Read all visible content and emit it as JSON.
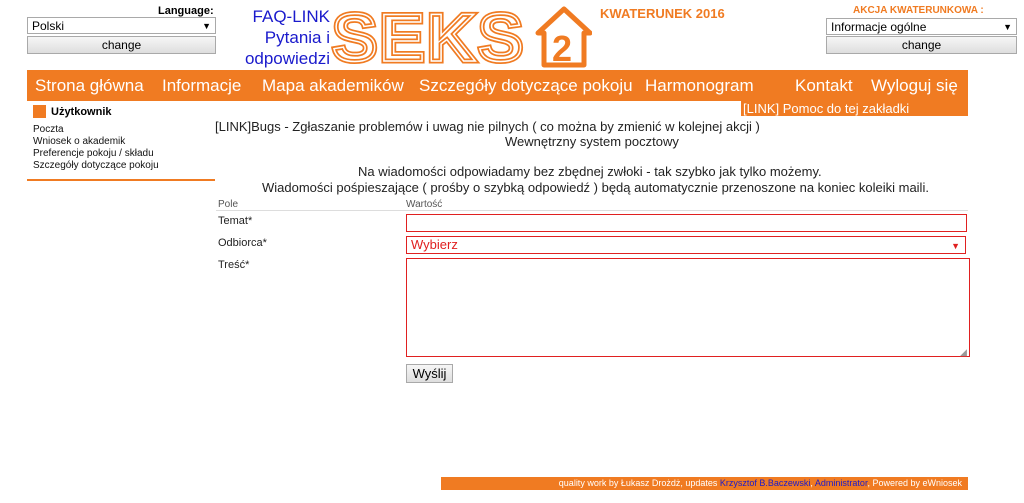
{
  "header": {
    "language_label": "Language:",
    "language_value": "Polski",
    "change_label": "change",
    "faq_line1": "FAQ-LINK",
    "faq_line2": "Pytania i",
    "faq_line3": "odpowiedzi",
    "logo_text": "SEKS",
    "logo_number": "2",
    "kwaterunek": "KWATERUNEK 2016",
    "akcja_label": "AKCJA KWATERUNKOWA :",
    "akcja_value": "Informacje ogólne",
    "akcja_change_label": "change"
  },
  "nav": {
    "items": [
      "Strona główna",
      "Informacje",
      "Mapa akademików",
      "Szczegóły dotyczące pokoju",
      "Harmonogram",
      "Kontakt",
      "Wyloguj się"
    ],
    "help_link": "[LINK] Pomoc do tej zakładki"
  },
  "sidebar": {
    "title": "Użytkownik",
    "items": [
      "Poczta",
      "Wniosek o akademik",
      "Preferencje pokoju / składu",
      "Szczegóły dotyczące pokoju"
    ]
  },
  "main": {
    "bugs_line": "[LINK]Bugs - Zgłaszanie problemów i uwag nie pilnych ( co można by zmienić w kolejnej akcji )",
    "mail_title": "Wewnętrzny system pocztowy",
    "notice1": "Na wiadomości odpowiadamy bez zbędnej zwłoki - tak szybko jak tylko możemy.",
    "notice2": "Wiadomości pośpieszające ( prośby o szybką odpowiedź ) będą automatycznie przenoszone na koniec koleiki maili.",
    "col_field": "Pole",
    "col_value": "Wartość",
    "subject_label": "Temat*",
    "recipient_label": "Odbiorca*",
    "recipient_value": "Wybierz",
    "body_label": "Treść*",
    "send_label": "Wyślij"
  },
  "footer": {
    "text1": "quality work by Łukasz Drożdż, updates ",
    "link1": "Krzysztof B.Baczewski",
    "sep": ", ",
    "link2": "Administrator",
    "text2": ", Powered by eWniosek"
  },
  "colors": {
    "accent": "#f07b22",
    "link": "#1a1acc",
    "error_border": "#e02020"
  }
}
